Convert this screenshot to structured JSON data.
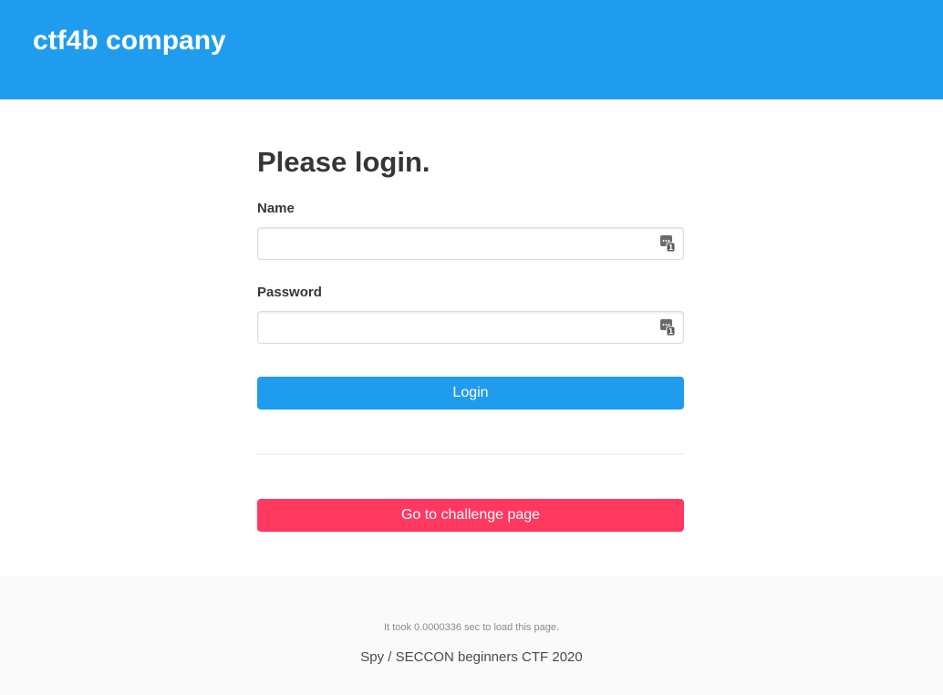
{
  "header": {
    "brand": "ctf4b company",
    "accent_color": "#209cee"
  },
  "login": {
    "title": "Please login.",
    "name_label": "Name",
    "name_value": "",
    "name_icon": "password-manager-icon",
    "password_label": "Password",
    "password_value": "",
    "password_icon": "password-manager-icon",
    "login_button": "Login",
    "challenge_button": "Go to challenge page",
    "challenge_color": "#ff3860"
  },
  "footer": {
    "load_time": "It took 0.0000336 sec to load this page.",
    "credit": "Spy / SECCON beginners CTF 2020"
  }
}
